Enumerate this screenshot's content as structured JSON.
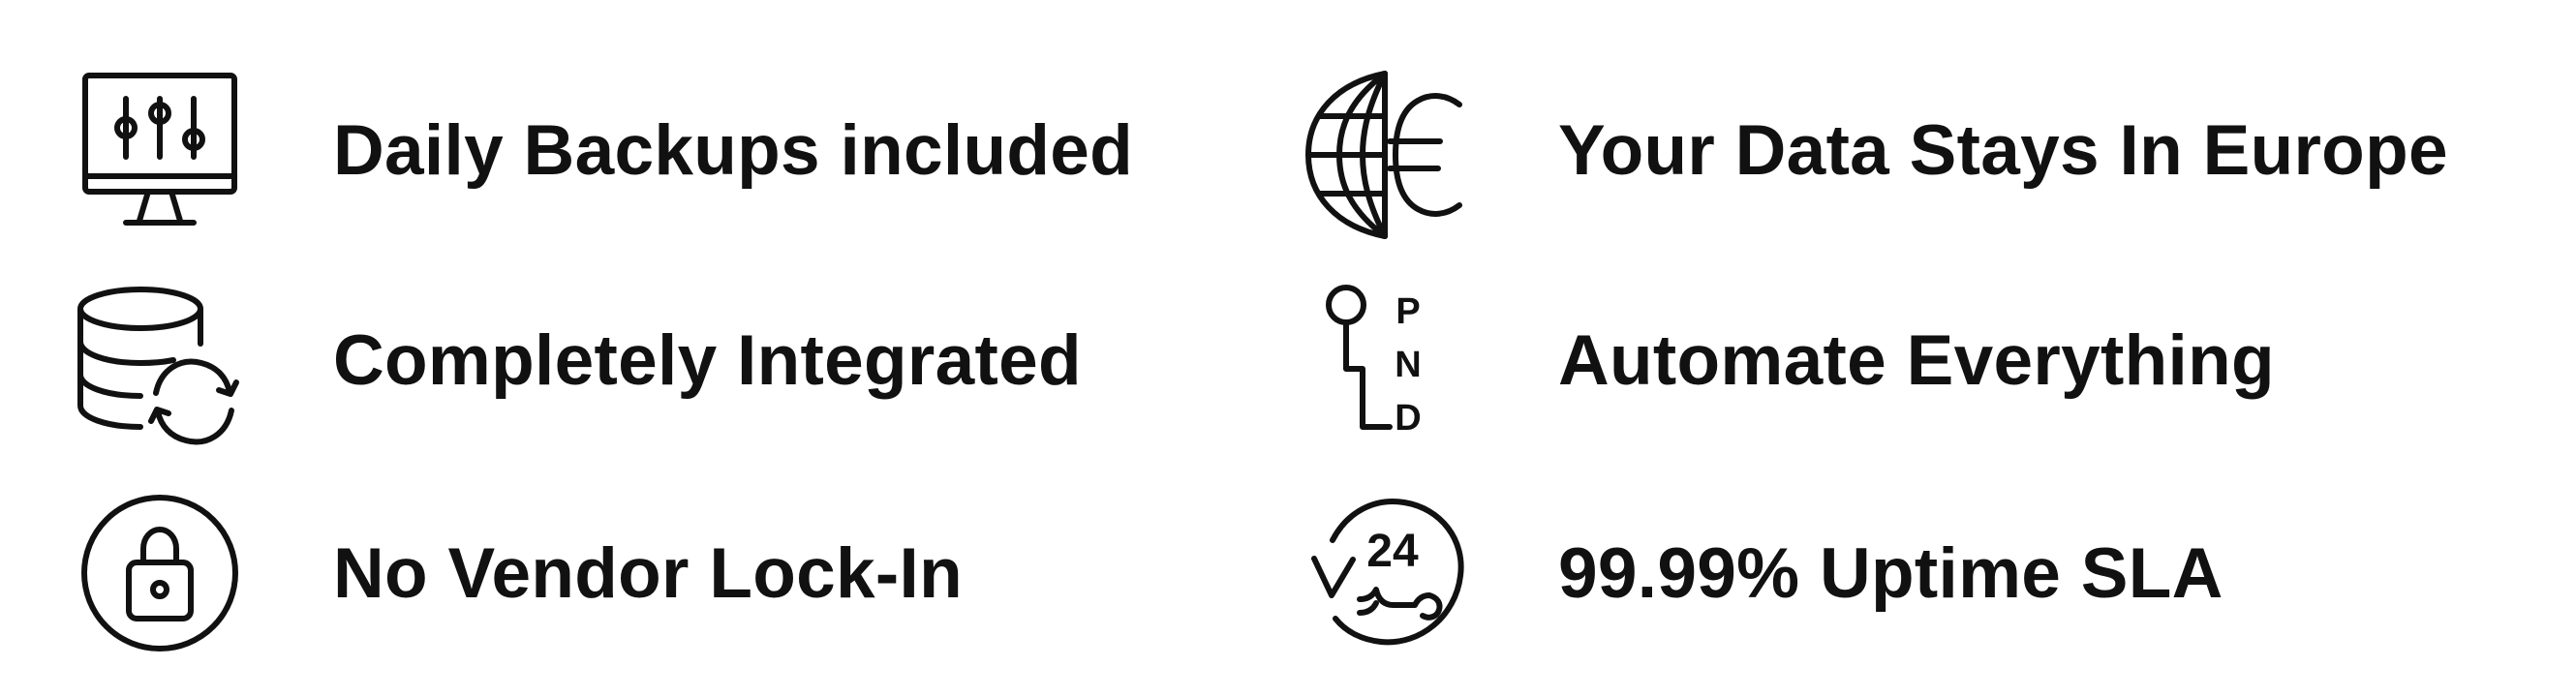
{
  "features": [
    {
      "label": "Daily Backups included",
      "icon": "monitor-sliders-icon"
    },
    {
      "label": "Your Data Stays In Europe",
      "icon": "globe-euro-icon"
    },
    {
      "label": "Completely Integrated",
      "icon": "database-sync-icon"
    },
    {
      "label": "Automate Everything",
      "icon": "pnd-automation-icon",
      "icon_letters": [
        "P",
        "N",
        "D"
      ]
    },
    {
      "label": "No Vendor Lock-In",
      "icon": "padlock-circle-icon"
    },
    {
      "label": "99.99% Uptime SLA",
      "icon": "support-24-icon",
      "icon_text": "24"
    }
  ],
  "colors": {
    "text": "#111111",
    "background": "#ffffff"
  }
}
